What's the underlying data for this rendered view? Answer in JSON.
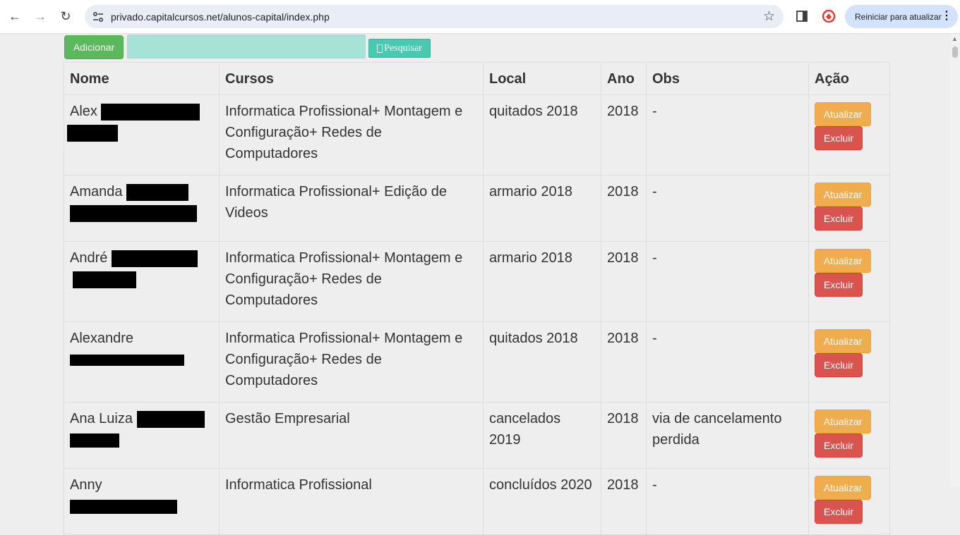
{
  "browser": {
    "url": "privado.capitalcursos.net/alunos-capital/index.php",
    "update_label": "Reiniciar para atualizar",
    "back_icon": "←",
    "forward_icon": "→",
    "reload_icon": "↻",
    "star_icon": "☆",
    "menu_icon": "⋮"
  },
  "toolbar": {
    "add_label": "Adicionar",
    "search_placeholder": "",
    "search_label": "Pesquisar"
  },
  "table": {
    "headers": [
      "Nome",
      "Cursos",
      "Local",
      "Ano",
      "Obs",
      "Ação"
    ],
    "rows": [
      {
        "nome": "Alex",
        "cursos": "Informatica Profissional+ Montagem e Configuração+ Redes de Computadores",
        "local": "quitados 2018",
        "ano": "2018",
        "obs": "-"
      },
      {
        "nome": "Amanda",
        "cursos": "Informatica Profissional+ Edição de Videos",
        "local": "armario 2018",
        "ano": "2018",
        "obs": "-"
      },
      {
        "nome": "André",
        "cursos": "Informatica Profissional+ Montagem e Configuração+ Redes de Computadores",
        "local": "armario 2018",
        "ano": "2018",
        "obs": "-"
      },
      {
        "nome": "Alexandre",
        "cursos": "Informatica Profissional+ Montagem e Configuração+ Redes de Computadores",
        "local": "quitados 2018",
        "ano": "2018",
        "obs": "-"
      },
      {
        "nome": "Ana Luiza",
        "cursos": "Gestão Empresarial",
        "local": "cancelados 2019",
        "ano": "2018",
        "obs": "via de cancelamento perdida"
      },
      {
        "nome": "Anny",
        "cursos": "Informatica Profissional",
        "local": "concluídos 2020",
        "ano": "2018",
        "obs": "-"
      }
    ],
    "update_label": "Atualizar",
    "delete_label": "Excluir"
  },
  "colors": {
    "add_button": "#5cb85c",
    "search_button": "#48c9b0",
    "update_button": "#f0ad4e",
    "delete_button": "#d9534f",
    "page_background": "#eeeeee"
  }
}
